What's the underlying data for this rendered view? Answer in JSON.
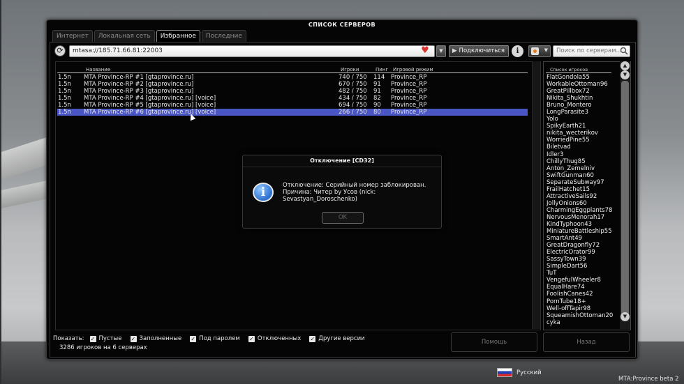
{
  "window": {
    "title": "СПИСОК СЕРВЕРОВ"
  },
  "tabs": [
    {
      "label": "Интернет",
      "active": false
    },
    {
      "label": "Локальная сеть",
      "active": false
    },
    {
      "label": "Избранное",
      "active": true
    },
    {
      "label": "Последние",
      "active": false
    }
  ],
  "toolbar": {
    "address": "mtasa://185.71.66.81:22003",
    "connect_label": "Подключиться",
    "search_placeholder": "Поиск по серверам..."
  },
  "server_list": {
    "columns": [
      "Название",
      "Игроки",
      "Пинг",
      "Игровой режим"
    ],
    "rows": [
      {
        "version": "1.5n",
        "name": "MTA Province-RP #1 [gtaprovince.ru]",
        "players": "740 / 750",
        "ping": "114",
        "mode": "Province_RP",
        "selected": false
      },
      {
        "version": "1.5n",
        "name": "MTA Province-RP #2 [gtaprovince.ru]",
        "players": "670 / 750",
        "ping": "91",
        "mode": "Province_RP",
        "selected": false
      },
      {
        "version": "1.5n",
        "name": "MTA Province-RP #3 [gtaprovince.ru]",
        "players": "482 / 750",
        "ping": "91",
        "mode": "Province_RP",
        "selected": false
      },
      {
        "version": "1.5n",
        "name": "MTA Province-RP #4 [gtaprovince.ru] [voice]",
        "players": "434 / 750",
        "ping": "82",
        "mode": "Province_RP",
        "selected": false
      },
      {
        "version": "1.5n",
        "name": "MTA Province-RP #5 [gtaprovince.ru] [voice]",
        "players": "694 / 750",
        "ping": "90",
        "mode": "Province_RP",
        "selected": false
      },
      {
        "version": "1.5n",
        "name": "MTA Province-RP #6 [gtaprovince.ru] [voice]",
        "players": "266 / 750",
        "ping": "80",
        "mode": "Province_RP",
        "selected": true
      }
    ]
  },
  "player_list": {
    "header": "Список игроков",
    "players": [
      "FlatGondola55",
      "WorkableOttoman96",
      "GreatPillbox72",
      "Nikita_Shukhtin",
      "Bruno_Montero",
      "LongParasite3",
      "Yolo",
      "SpikyEarth21",
      "nikita_wecterikov",
      "WorriedPine55",
      "Biletvad",
      "Idler3",
      "ChillyThug85",
      "Anton_Zemelniv",
      "SwiftGunman60",
      "SeparateSubway97",
      "FrailHatchet15",
      "AttractiveSails92",
      "JollyOnions60",
      "CharmingEggplants78",
      "NervousMenorah17",
      "KindTyphoon43",
      "MiniatureBattleship55",
      "SmartAnt49",
      "GreatDragonfly72",
      "ElectricOrator99",
      "SassyTown39",
      "SimpleDart56",
      "TuT",
      "VengefulWheeler8",
      "EqualHare74",
      "FoolishCanes42",
      "PornTube18+",
      "Well-offTapir98",
      "SqueamishOttoman20",
      "cyka"
    ]
  },
  "dialog": {
    "title": "Отключение [CD32]",
    "message_line1": "Отключение: Серийный номер заблокирован.",
    "message_line2": "Причина: Читер by Усов (nick:",
    "message_line3": "Sevastyan_Doroschenko)",
    "ok_label": "OK"
  },
  "filters": {
    "label": "Показать:",
    "options": [
      {
        "label": "Пустые",
        "checked": true
      },
      {
        "label": "Заполненные",
        "checked": true
      },
      {
        "label": "Под паролем",
        "checked": true
      },
      {
        "label": "Отключенных",
        "checked": true
      },
      {
        "label": "Другие версии",
        "checked": true
      }
    ]
  },
  "status": {
    "count_text": "3286 игроков на 6 серверах"
  },
  "buttons": {
    "help": "Помощь",
    "back": "Назад"
  },
  "language": {
    "label": "Русский"
  },
  "version": {
    "text": "MTA:Province beta 2"
  },
  "colors": {
    "selection": "#4a56c4",
    "window_bg": "#050505",
    "heart": "#d8342f"
  },
  "icons": [
    "refresh-icon",
    "heart-icon",
    "play-icon",
    "info-icon",
    "search-icon",
    "info-bubble-icon",
    "check-icon",
    "flag-icon"
  ]
}
